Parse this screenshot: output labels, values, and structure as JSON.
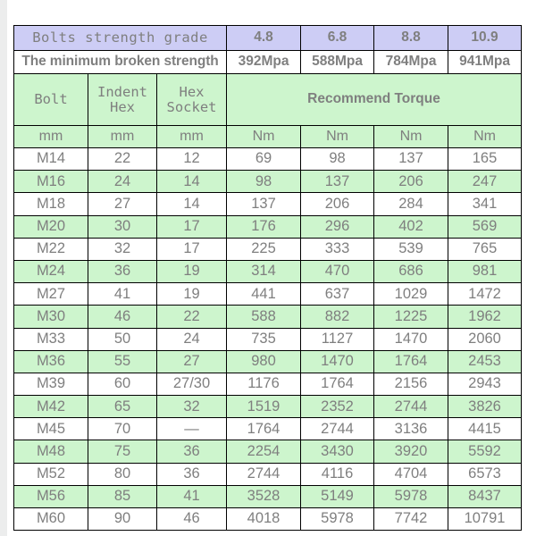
{
  "table": {
    "header": {
      "grade_label": "Bolts strength grade",
      "grades": [
        "4.8",
        "6.8",
        "8.8",
        "10.9"
      ],
      "strength_label": "The minimum broken strength",
      "strengths": [
        "392Mpa",
        "588Mpa",
        "784Mpa",
        "941Mpa"
      ],
      "col_bolt": "Bolt",
      "col_indent_hex_l1": "Indent",
      "col_indent_hex_l2": "Hex",
      "col_hex_socket_l1": "Hex",
      "col_hex_socket_l2": "Socket",
      "recommend_torque": "Recommend Torque",
      "units": [
        "mm",
        "mm",
        "mm",
        "Nm",
        "Nm",
        "Nm",
        "Nm"
      ]
    },
    "columns": [
      "Bolt",
      "Indent Hex",
      "Hex Socket",
      "4.8",
      "6.8",
      "8.8",
      "10.9"
    ],
    "rows": [
      [
        "M14",
        "22",
        "12",
        "69",
        "98",
        "137",
        "165"
      ],
      [
        "M16",
        "24",
        "14",
        "98",
        "137",
        "206",
        "247"
      ],
      [
        "M18",
        "27",
        "14",
        "137",
        "206",
        "284",
        "341"
      ],
      [
        "M20",
        "30",
        "17",
        "176",
        "296",
        "402",
        "569"
      ],
      [
        "M22",
        "32",
        "17",
        "225",
        "333",
        "539",
        "765"
      ],
      [
        "M24",
        "36",
        "19",
        "314",
        "470",
        "686",
        "981"
      ],
      [
        "M27",
        "41",
        "19",
        "441",
        "637",
        "1029",
        "1472"
      ],
      [
        "M30",
        "46",
        "22",
        "588",
        "882",
        "1225",
        "1962"
      ],
      [
        "M33",
        "50",
        "24",
        "735",
        "1127",
        "1470",
        "2060"
      ],
      [
        "M36",
        "55",
        "27",
        "980",
        "1470",
        "1764",
        "2453"
      ],
      [
        "M39",
        "60",
        "27/30",
        "1176",
        "1764",
        "2156",
        "2943"
      ],
      [
        "M42",
        "65",
        "32",
        "1519",
        "2352",
        "2744",
        "3826"
      ],
      [
        "M45",
        "70",
        "—",
        "1764",
        "2744",
        "3136",
        "4415"
      ],
      [
        "M48",
        "75",
        "36",
        "2254",
        "3430",
        "3920",
        "5592"
      ],
      [
        "M52",
        "80",
        "36",
        "2744",
        "4116",
        "4704",
        "6573"
      ],
      [
        "M56",
        "85",
        "41",
        "3528",
        "5149",
        "5978",
        "8437"
      ],
      [
        "M60",
        "90",
        "46",
        "4018",
        "5978",
        "7742",
        "10791"
      ]
    ]
  },
  "colors": {
    "header_purple": "#cdcdf5",
    "header_green": "#cdf5cd",
    "text_gray": "#7f7f7f",
    "border": "#000000",
    "page_bg": "#ffffff",
    "canvas_bg": "#eceded"
  }
}
